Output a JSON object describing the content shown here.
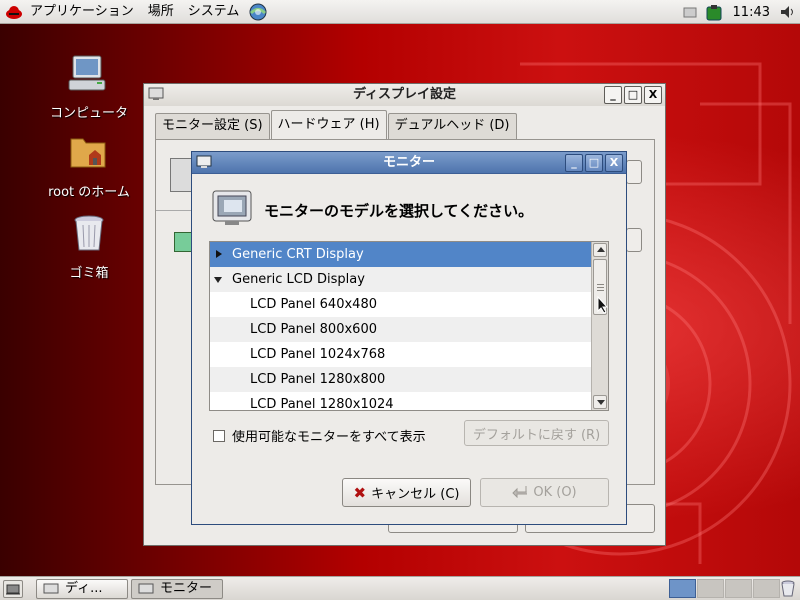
{
  "top_panel": {
    "menus": [
      "アプリケーション",
      "場所",
      "システム"
    ],
    "clock": "11:43"
  },
  "desktop": {
    "icons": [
      {
        "label": "コンピュータ",
        "icon": "computer-icon"
      },
      {
        "label": "root のホーム",
        "icon": "home-folder-icon"
      },
      {
        "label": "ゴミ箱",
        "icon": "trash-icon"
      }
    ]
  },
  "display_window": {
    "title": "ディスプレイ設定",
    "tabs": [
      "モニター設定 (S)",
      "ハードウェア (H)",
      "デュアルヘッド (D)"
    ],
    "active_tab": 1,
    "window_buttons": [
      "_",
      "□",
      "X"
    ]
  },
  "monitor_dialog": {
    "title": "モニター",
    "heading": "モニターのモデルを選択してください。",
    "rows": [
      {
        "label": "Generic CRT Display",
        "kind": "parent",
        "expanded": false,
        "selected": true
      },
      {
        "label": "Generic LCD Display",
        "kind": "parent",
        "expanded": true,
        "selected": false
      },
      {
        "label": "LCD Panel 640x480",
        "kind": "child"
      },
      {
        "label": "LCD Panel 800x600",
        "kind": "child"
      },
      {
        "label": "LCD Panel 1024x768",
        "kind": "child"
      },
      {
        "label": "LCD Panel 1280x800",
        "kind": "child"
      },
      {
        "label": "LCD Panel 1280x1024",
        "kind": "child"
      }
    ],
    "show_all_checkbox": {
      "label": "使用可能なモニターをすべて表示",
      "checked": false
    },
    "default_button": "デフォルトに戻す (R)",
    "cancel_button": "キャンセル (C)",
    "ok_button": "OK (O)",
    "window_buttons": [
      "_",
      "□",
      "X"
    ]
  },
  "taskbar": {
    "tasks": [
      {
        "label": "ディ...",
        "pressed": false
      },
      {
        "label": "モニター",
        "pressed": true
      }
    ],
    "workspaces": 4,
    "active_workspace": 0
  },
  "colors": {
    "selection": "#5185c8",
    "titlebar_active": "#4e74ad",
    "desktop_red": "#b30000"
  }
}
